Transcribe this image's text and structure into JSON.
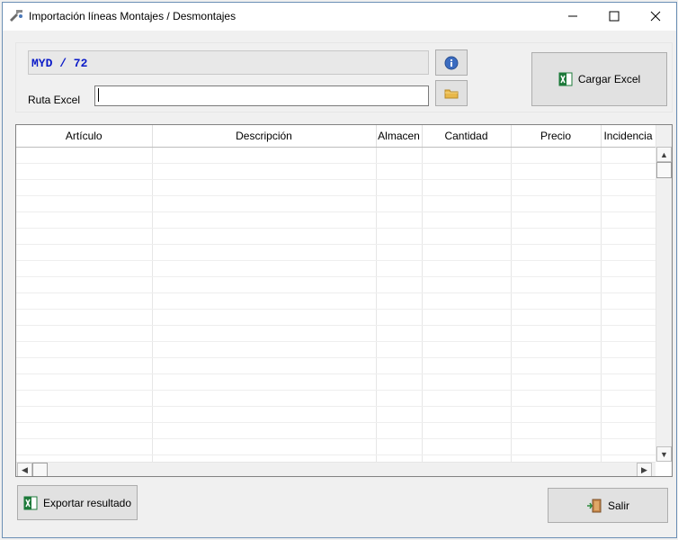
{
  "window": {
    "title": "Importación líneas Montajes / Desmontajes"
  },
  "header": {
    "code": "MYD / 72",
    "ruta_label": "Ruta Excel",
    "ruta_value": ""
  },
  "buttons": {
    "cargar": "Cargar Excel",
    "exportar": "Exportar resultado",
    "salir": "Salir"
  },
  "grid": {
    "columns": [
      "Artículo",
      "Descripción",
      "Almacen",
      "Cantidad",
      "Precio",
      "Incidencia"
    ],
    "rows": []
  },
  "colors": {
    "code_text": "#0a1ac8",
    "excel_green": "#1d7a3a",
    "info_blue": "#3b6cc0",
    "folder_yellow": "#e8b84a"
  },
  "icons": [
    "app-icon",
    "minimize-icon",
    "maximize-icon",
    "close-icon",
    "info-icon",
    "folder-icon",
    "excel-icon",
    "exit-door-icon"
  ]
}
